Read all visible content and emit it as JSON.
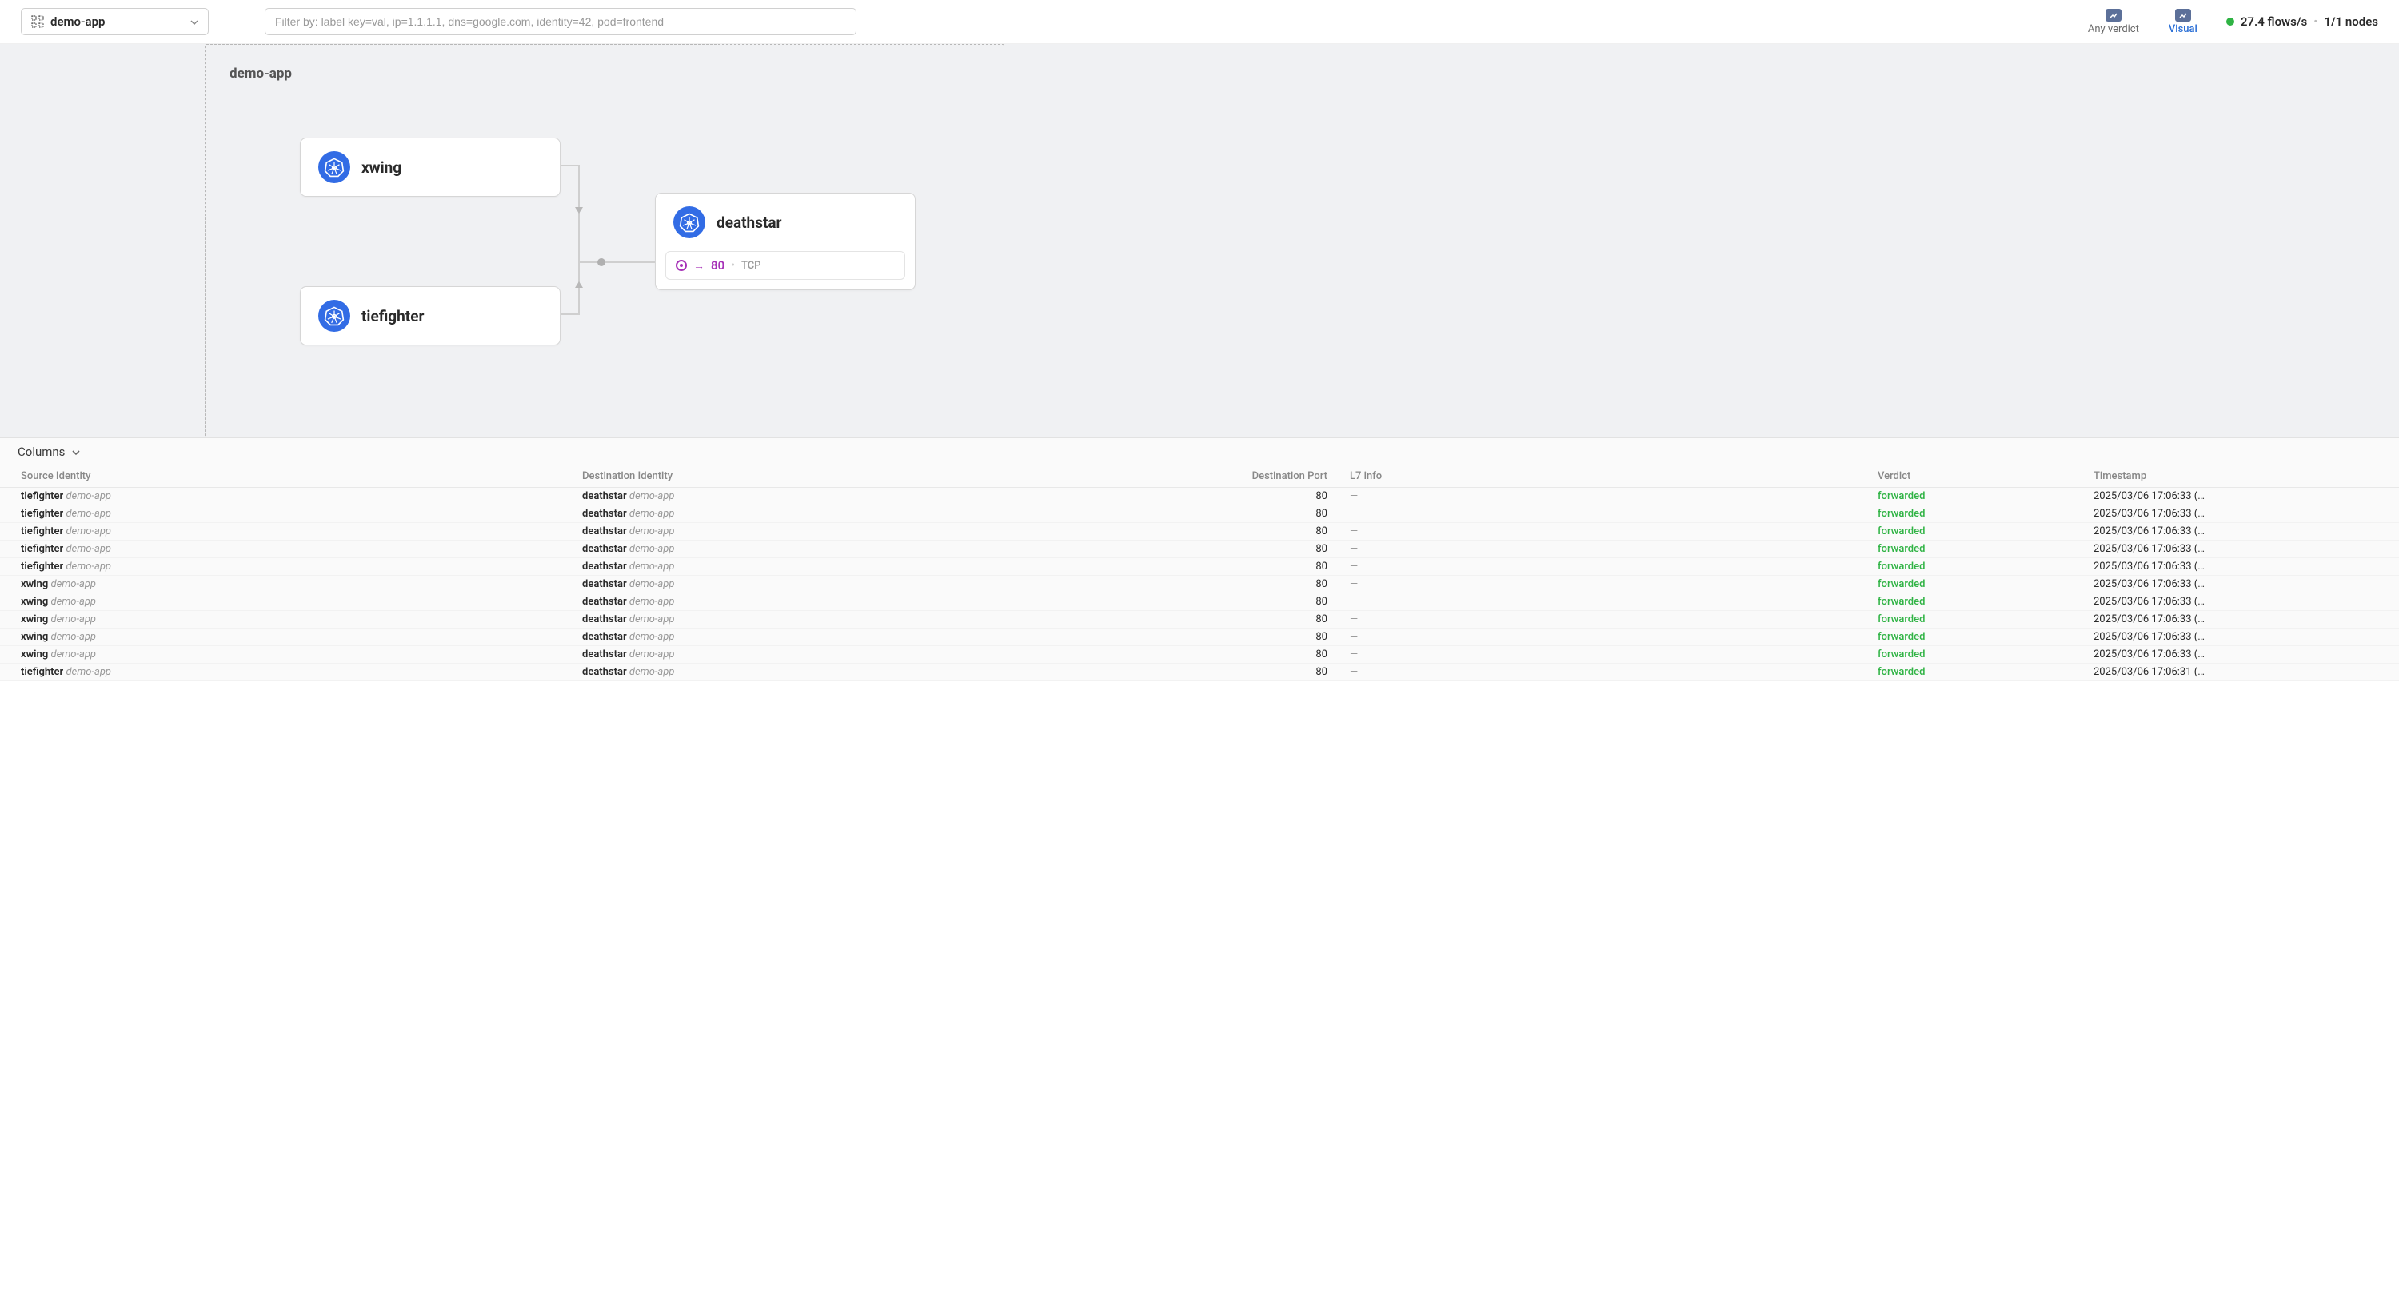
{
  "toolbar": {
    "namespace": "demo-app",
    "filter_placeholder": "Filter by: label key=val, ip=1.1.1.1, dns=google.com, identity=42, pod=frontend",
    "modes": {
      "any_verdict": "Any verdict",
      "visual": "Visual"
    },
    "status": {
      "flows_rate": "27.4 flows/s",
      "nodes": "1/1 nodes"
    }
  },
  "canvas": {
    "namespace_label": "demo-app",
    "nodes": {
      "xwing": {
        "title": "xwing"
      },
      "tiefighter": {
        "title": "tiefighter"
      },
      "deathstar": {
        "title": "deathstar",
        "port": {
          "number": "80",
          "proto": "TCP"
        }
      }
    }
  },
  "flows": {
    "columns_label": "Columns",
    "headers": {
      "src": "Source Identity",
      "dst": "Destination Identity",
      "port": "Destination Port",
      "l7": "L7 info",
      "verdict": "Verdict",
      "ts": "Timestamp"
    },
    "rows": [
      {
        "src": "tiefighter",
        "src_ns": "demo-app",
        "dst": "deathstar",
        "dst_ns": "demo-app",
        "port": "80",
        "l7": "—",
        "verdict": "forwarded",
        "ts": "2025/03/06 17:06:33 (…"
      },
      {
        "src": "tiefighter",
        "src_ns": "demo-app",
        "dst": "deathstar",
        "dst_ns": "demo-app",
        "port": "80",
        "l7": "—",
        "verdict": "forwarded",
        "ts": "2025/03/06 17:06:33 (…"
      },
      {
        "src": "tiefighter",
        "src_ns": "demo-app",
        "dst": "deathstar",
        "dst_ns": "demo-app",
        "port": "80",
        "l7": "—",
        "verdict": "forwarded",
        "ts": "2025/03/06 17:06:33 (…"
      },
      {
        "src": "tiefighter",
        "src_ns": "demo-app",
        "dst": "deathstar",
        "dst_ns": "demo-app",
        "port": "80",
        "l7": "—",
        "verdict": "forwarded",
        "ts": "2025/03/06 17:06:33 (…"
      },
      {
        "src": "tiefighter",
        "src_ns": "demo-app",
        "dst": "deathstar",
        "dst_ns": "demo-app",
        "port": "80",
        "l7": "—",
        "verdict": "forwarded",
        "ts": "2025/03/06 17:06:33 (…"
      },
      {
        "src": "xwing",
        "src_ns": "demo-app",
        "dst": "deathstar",
        "dst_ns": "demo-app",
        "port": "80",
        "l7": "—",
        "verdict": "forwarded",
        "ts": "2025/03/06 17:06:33 (…"
      },
      {
        "src": "xwing",
        "src_ns": "demo-app",
        "dst": "deathstar",
        "dst_ns": "demo-app",
        "port": "80",
        "l7": "—",
        "verdict": "forwarded",
        "ts": "2025/03/06 17:06:33 (…"
      },
      {
        "src": "xwing",
        "src_ns": "demo-app",
        "dst": "deathstar",
        "dst_ns": "demo-app",
        "port": "80",
        "l7": "—",
        "verdict": "forwarded",
        "ts": "2025/03/06 17:06:33 (…"
      },
      {
        "src": "xwing",
        "src_ns": "demo-app",
        "dst": "deathstar",
        "dst_ns": "demo-app",
        "port": "80",
        "l7": "—",
        "verdict": "forwarded",
        "ts": "2025/03/06 17:06:33 (…"
      },
      {
        "src": "xwing",
        "src_ns": "demo-app",
        "dst": "deathstar",
        "dst_ns": "demo-app",
        "port": "80",
        "l7": "—",
        "verdict": "forwarded",
        "ts": "2025/03/06 17:06:33 (…"
      },
      {
        "src": "tiefighter",
        "src_ns": "demo-app",
        "dst": "deathstar",
        "dst_ns": "demo-app",
        "port": "80",
        "l7": "—",
        "verdict": "forwarded",
        "ts": "2025/03/06 17:06:31 (…"
      }
    ]
  }
}
